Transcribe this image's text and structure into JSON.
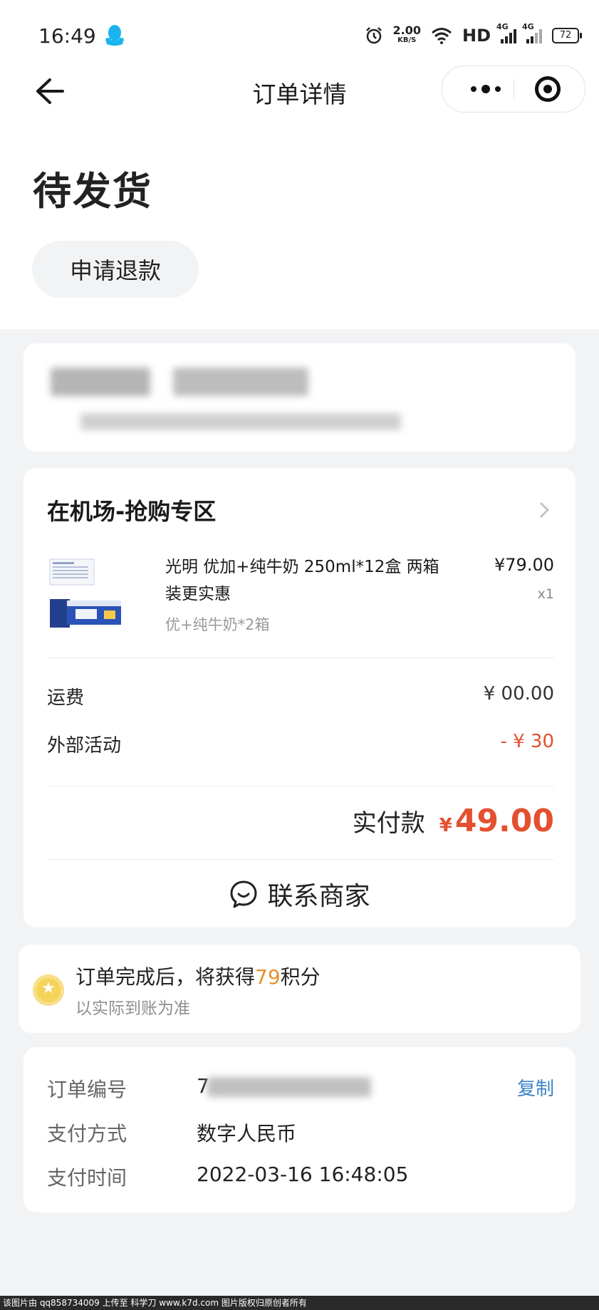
{
  "statusbar": {
    "time": "16:49",
    "speed_value": "2.00",
    "speed_unit": "KB/S",
    "network_label": "HD",
    "signal_label": "4G",
    "battery": "72"
  },
  "navbar": {
    "title": "订单详情"
  },
  "order_status": "待发货",
  "refund_button": "申请退款",
  "shop": {
    "name": "在机场-抢购专区"
  },
  "product": {
    "title": "光明 优加+纯牛奶 250ml*12盒 两箱装更实惠",
    "spec": "优+纯牛奶*2箱",
    "price": "¥79.00",
    "quantity": "x1"
  },
  "fees": {
    "shipping_label": "运费",
    "shipping_value": "¥ 00.00",
    "discount_label": "外部活动",
    "discount_value": "- ¥ 30"
  },
  "payment": {
    "label": "实付款",
    "currency": "¥",
    "amount": "49.00"
  },
  "contact_label": "联系商家",
  "points": {
    "prefix": "订单完成后，将获得",
    "value": "79",
    "suffix": "积分",
    "note": "以实际到账为准"
  },
  "order_info": {
    "number_label": "订单编号",
    "number_value": "7",
    "copy_label": "复制",
    "pay_method_label": "支付方式",
    "pay_method_value": "数字人民币",
    "pay_time_label": "支付时间",
    "pay_time_value": "2022-03-16 16:48:05"
  },
  "footer_text": "该图片由 qq858734009 上传至 科学刀 www.k7d.com 图片版权归原创者所有",
  "colors": {
    "accent_red": "#e4502f",
    "points_orange": "#e8902e",
    "link_blue": "#3b82c6"
  }
}
